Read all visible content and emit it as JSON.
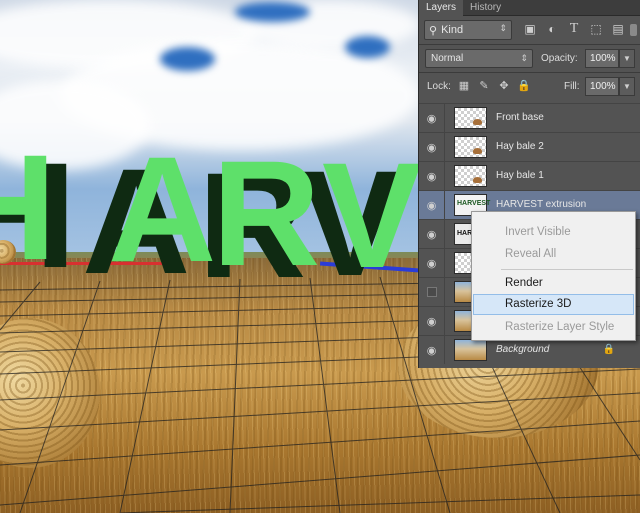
{
  "panel": {
    "tabs": [
      {
        "label": "Layers",
        "active": true
      },
      {
        "label": "History",
        "active": false
      }
    ],
    "filter": {
      "kind_label": "Kind",
      "icons": [
        "image-filter-icon",
        "adjustment-filter-icon",
        "type-filter-icon",
        "shape-filter-icon",
        "smart-object-filter-icon"
      ]
    },
    "blend_mode": "Normal",
    "opacity_label": "Opacity:",
    "opacity_value": "100%",
    "lock_label": "Lock:",
    "lock_icons": [
      "lock-transparent-pixels-icon",
      "lock-image-pixels-icon",
      "lock-position-icon",
      "lock-all-icon"
    ],
    "fill_label": "Fill:",
    "fill_value": "100%",
    "layers": [
      {
        "name": "Front base",
        "visible": true,
        "selected": false,
        "thumb": "transparent-bale"
      },
      {
        "name": "Hay bale 2",
        "visible": true,
        "selected": false,
        "thumb": "transparent-bale"
      },
      {
        "name": "Hay bale 1",
        "visible": true,
        "selected": false,
        "thumb": "transparent-bale"
      },
      {
        "name": "HARVEST extrusion",
        "visible": true,
        "selected": true,
        "thumb": "3d-text"
      },
      {
        "name": "",
        "visible": true,
        "selected": false,
        "thumb": "dark-text"
      },
      {
        "name": "",
        "visible": true,
        "selected": false,
        "thumb": "transparent"
      },
      {
        "name": "",
        "visible": false,
        "selected": false,
        "thumb": "photo"
      },
      {
        "name": "",
        "visible": true,
        "selected": false,
        "thumb": "photo"
      },
      {
        "name": "Background",
        "visible": true,
        "selected": false,
        "thumb": "photo",
        "locked": true
      }
    ]
  },
  "context_menu": {
    "items": [
      {
        "label": "Invert Visible",
        "enabled": false
      },
      {
        "label": "Reveal All",
        "enabled": false
      },
      {
        "label": "Render",
        "enabled": true
      },
      {
        "label": "Rasterize 3D",
        "enabled": true,
        "highlighted": true
      },
      {
        "label": "Rasterize Layer Style",
        "enabled": false
      }
    ]
  },
  "canvas": {
    "text_3d": "HARVEST",
    "text_color": "#5ee06a",
    "extrusion_color": "#0f2a12"
  },
  "colors": {
    "panel_bg": "#535353",
    "selected_layer": "#6a7a97",
    "menu_highlight": "#d6e7f8"
  }
}
